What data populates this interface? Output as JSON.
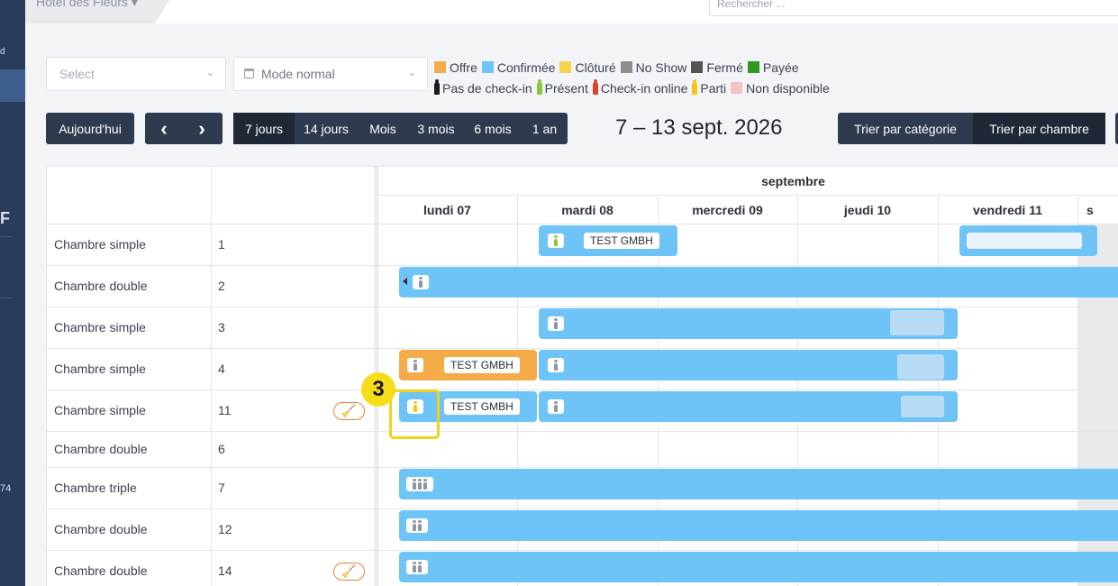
{
  "header": {
    "hotel_name": "Hôtel des Fleurs",
    "search_placeholder": "Rechercher ..."
  },
  "sidebar": {
    "frag1": "d",
    "frag2": "F",
    "frag3": "74"
  },
  "filters": {
    "select_placeholder": "Select",
    "mode_label": "Mode normal"
  },
  "legend": {
    "row1": [
      {
        "label": "Offre",
        "color": "#f5ac48"
      },
      {
        "label": "Confirmée",
        "color": "#6ec3f7"
      },
      {
        "label": "Clôturé",
        "color": "#f7d24a"
      },
      {
        "label": "No Show",
        "color": "#8e8e8e"
      },
      {
        "label": "Fermé",
        "color": "#545454"
      },
      {
        "label": "Payée",
        "color": "#2e9a1e"
      }
    ],
    "row2": [
      {
        "label": "Pas de check-in",
        "color": "#1a1a1a"
      },
      {
        "label": "Présent",
        "color": "#8cc63f"
      },
      {
        "label": "Check-in online",
        "color": "#d9432b"
      },
      {
        "label": "Parti",
        "color": "#f5c518"
      },
      {
        "label": "Non disponible",
        "color": "#f2c4c4"
      }
    ]
  },
  "toolbar": {
    "today": "Aujourd'hui",
    "prev": "‹",
    "next": "›",
    "periods": [
      "7 jours",
      "14 jours",
      "Mois",
      "3 mois",
      "6 mois",
      "1 an"
    ],
    "active_period": "7 jours",
    "range_title": "7 – 13 sept. 2026",
    "sort_category": "Trier par catégorie",
    "sort_room": "Trier par chambre"
  },
  "calendar": {
    "month": "septembre",
    "days": [
      "lundi 07",
      "mardi 08",
      "mercredi 09",
      "jeudi 10",
      "vendredi 11",
      "s"
    ],
    "rows": [
      {
        "category": "Chambre simple",
        "room": "1",
        "cleaning": false
      },
      {
        "category": "Chambre double",
        "room": "2",
        "cleaning": false
      },
      {
        "category": "Chambre simple",
        "room": "3",
        "cleaning": false
      },
      {
        "category": "Chambre simple",
        "room": "4",
        "cleaning": false
      },
      {
        "category": "Chambre simple",
        "room": "11",
        "cleaning": true
      },
      {
        "category": "Chambre double",
        "room": "6",
        "cleaning": false
      },
      {
        "category": "Chambre triple",
        "room": "7",
        "cleaning": false
      },
      {
        "category": "Chambre double",
        "room": "12",
        "cleaning": false
      },
      {
        "category": "Chambre double",
        "room": "14",
        "cleaning": true
      }
    ],
    "booking_name": "TEST GMBH"
  },
  "annotation": {
    "step": "3",
    "color": "#f2d21b"
  }
}
